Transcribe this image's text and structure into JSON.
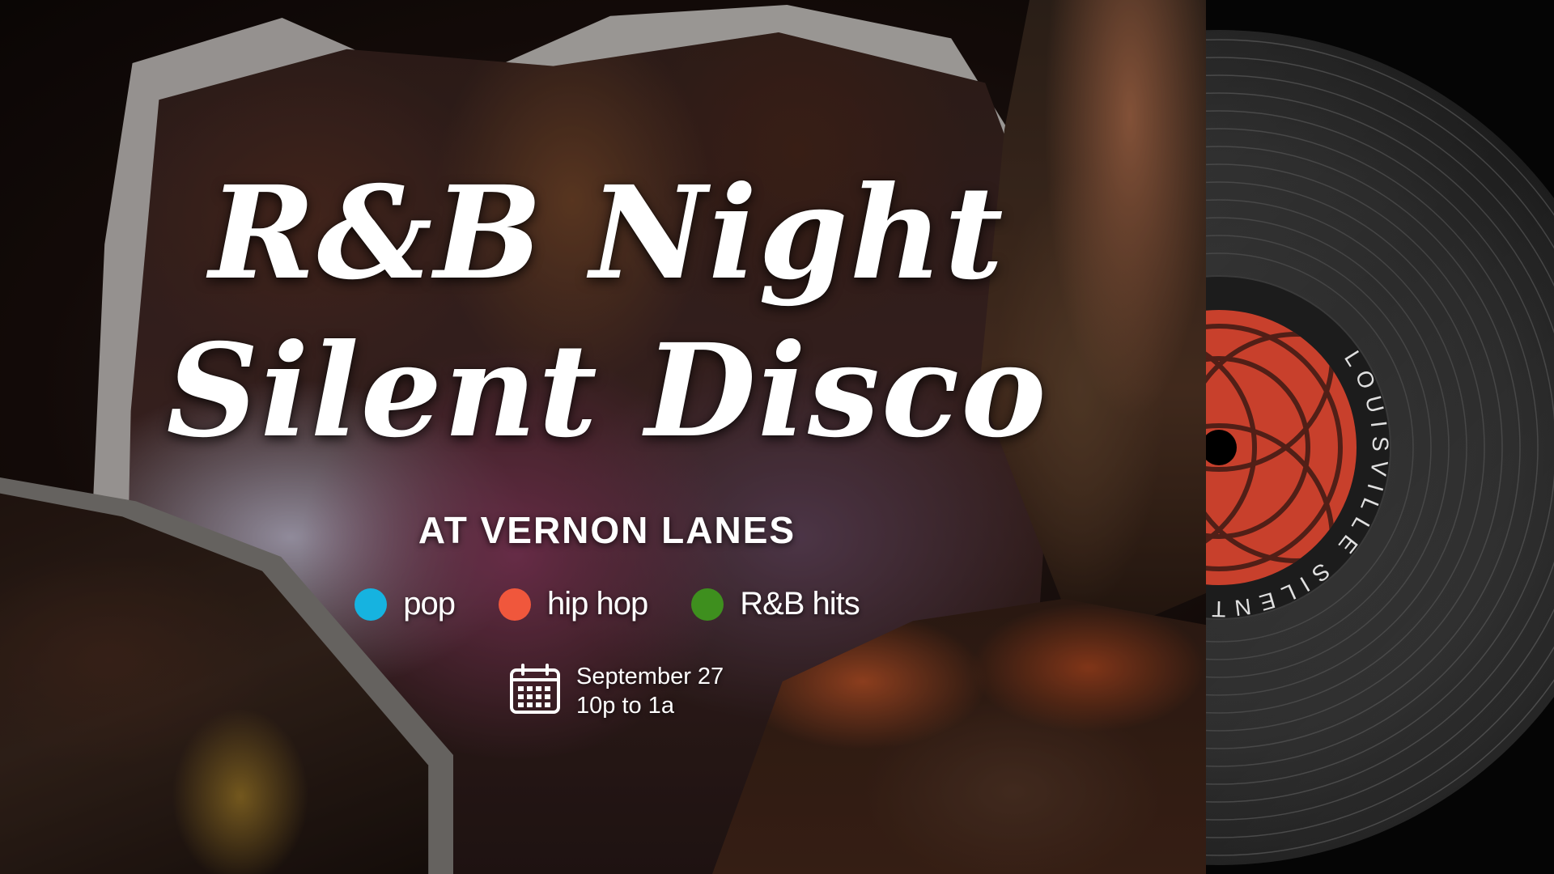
{
  "title": {
    "line1": "R&B Night",
    "line2": "Silent Disco"
  },
  "venue": "AT VERNON LANES",
  "genres": [
    {
      "label": "pop",
      "color": "#16b3e0"
    },
    {
      "label": "hip hop",
      "color": "#f0573c"
    },
    {
      "label": "R&B hits",
      "color": "#3e8f1e"
    }
  ],
  "event": {
    "date": "September 27",
    "time": "10p to 1a",
    "icon": "calendar-icon"
  },
  "record_label": {
    "text": "LOUISVILLE SILENT DISCO",
    "label_color": "#c8402c"
  },
  "colors": {
    "text": "#ffffff",
    "panel": "#050505",
    "vinyl": "#2b2b2b"
  }
}
